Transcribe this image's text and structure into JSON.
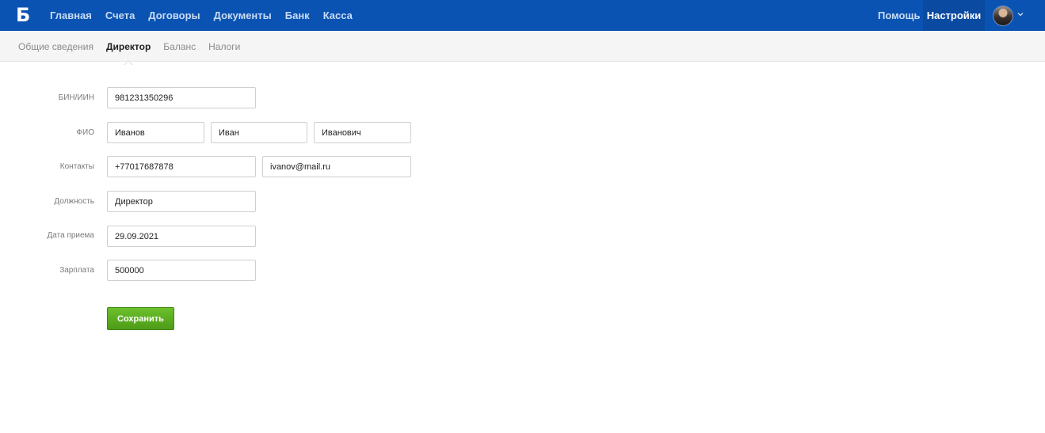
{
  "header": {
    "logo": "Б",
    "nav": [
      "Главная",
      "Счета",
      "Договоры",
      "Документы",
      "Банк",
      "Касса"
    ],
    "help": "Помощь",
    "settings": "Настройки"
  },
  "subnav": {
    "items": [
      "Общие сведения",
      "Директор",
      "Баланс",
      "Налоги"
    ],
    "active": "Директор"
  },
  "form": {
    "bin_label": "БИН/ИИН",
    "bin_value": "981231350296",
    "fio_label": "ФИО",
    "last_name": "Иванов",
    "first_name": "Иван",
    "middle_name": "Иванович",
    "contacts_label": "Контакты",
    "phone": "+77017687878",
    "email": "ivanov@mail.ru",
    "position_label": "Должность",
    "position_value": "Директор",
    "hire_date_label": "Дата приема",
    "hire_date_value": "29.09.2021",
    "salary_label": "Зарплата",
    "salary_value": "500000",
    "save_label": "Сохранить"
  },
  "colors": {
    "header_bg": "#0b53b2",
    "settings_bg": "#0a4aa0",
    "save_button": "#5aad20"
  }
}
